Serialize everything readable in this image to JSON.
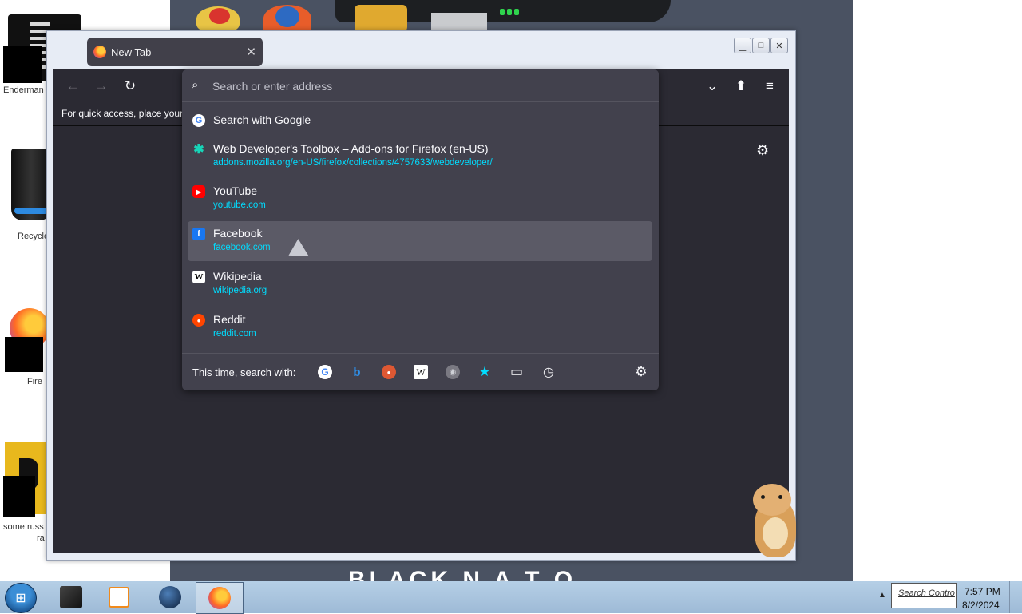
{
  "desktop": {
    "icons": [
      {
        "label": "Enderman"
      },
      {
        "label": "Recycle"
      },
      {
        "label": "Fire"
      },
      {
        "label": "some russ",
        "label2": "ra"
      }
    ],
    "wallpaper_text": "BLACK N A T O"
  },
  "browser": {
    "tab": {
      "title": "New Tab",
      "close_glyph": "✕"
    },
    "new_tab_glyph": "—",
    "caption": {
      "minimize": "▁",
      "maximize": "□",
      "close": "✕"
    },
    "toolbar": {
      "back_icon": "←",
      "forward_icon": "→",
      "reload_icon": "↻",
      "pocket_icon": "⌄",
      "extensions_icon": "⬆",
      "menu_icon": "≡"
    },
    "bookmarks_bar_text": "For quick access, place your b",
    "newtab_gear_icon": "⚙"
  },
  "urlbar": {
    "placeholder": "Search or enter address",
    "search_icon": "⌕",
    "results": [
      {
        "icon": "G",
        "icon_color": "#4285f4",
        "icon_bg": "#ffffff",
        "title": "Search with Google",
        "url": ""
      },
      {
        "icon": "✱",
        "icon_color": "#17d5b8",
        "icon_bg": "transparent",
        "title": "Web Developer's Toolbox – Add-ons for Firefox (en-US)",
        "url": "addons.mozilla.org/en-US/firefox/collections/4757633/webdeveloper/"
      },
      {
        "icon": "▶",
        "icon_color": "#ffffff",
        "icon_bg": "#ff0000",
        "title": "YouTube",
        "url": "youtube.com"
      },
      {
        "icon": "f",
        "icon_color": "#ffffff",
        "icon_bg": "#1877f2",
        "title": "Facebook",
        "url": "facebook.com"
      },
      {
        "icon": "W",
        "icon_color": "#000000",
        "icon_bg": "#ffffff",
        "title": "Wikipedia",
        "url": "wikipedia.org"
      },
      {
        "icon": "●",
        "icon_color": "#ffffff",
        "icon_bg": "#ff4500",
        "title": "Reddit",
        "url": "reddit.com"
      }
    ],
    "selected_index": 3,
    "one_off": {
      "label": "This time, search with:",
      "engines": [
        {
          "name": "google",
          "glyph": "G",
          "color": "#4285f4",
          "bg": "#ffffff"
        },
        {
          "name": "bing",
          "glyph": "b",
          "color": "#2f8fe8",
          "bg": "transparent"
        },
        {
          "name": "duckduckgo",
          "glyph": "●",
          "color": "#ffffff",
          "bg": "#de5833"
        },
        {
          "name": "wikipedia",
          "glyph": "W",
          "color": "#000000",
          "bg": "#ffffff"
        },
        {
          "name": "search",
          "glyph": "◉",
          "color": "#cfd0d6",
          "bg": "#7a7982"
        },
        {
          "name": "bookmarks",
          "glyph": "★",
          "color": "#00ddff",
          "bg": "transparent"
        },
        {
          "name": "tabs",
          "glyph": "▭",
          "color": "#fbfbfe",
          "bg": "transparent"
        },
        {
          "name": "history",
          "glyph": "◷",
          "color": "#fbfbfe",
          "bg": "transparent"
        }
      ],
      "settings_icon": "⚙"
    }
  },
  "taskbar": {
    "start_glyph": "⊞",
    "tray_arrow": "▲",
    "tray_text": "Search Contro",
    "time": "7:57 PM",
    "date": "8/2/2024"
  }
}
